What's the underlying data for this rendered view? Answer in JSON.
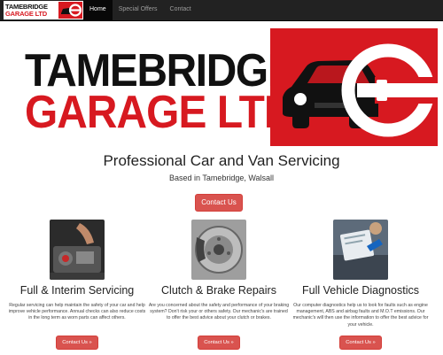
{
  "brand": {
    "nav_logo_line1": "TAMEBRIDGE",
    "nav_logo_line2": "GARAGE LTD",
    "banner_line1": "TAMEBRIDGE",
    "banner_line2": "GARAGE LTD",
    "accent_color": "#d71920"
  },
  "nav": {
    "items": [
      {
        "label": "Home",
        "active": true
      },
      {
        "label": "Special Offers",
        "active": false
      },
      {
        "label": "Contact",
        "active": false
      }
    ]
  },
  "hero": {
    "title": "Professional Car and Van Servicing",
    "subtitle": "Based in Tamebridge, Walsall",
    "button_label": "Contact Us"
  },
  "features": [
    {
      "title": "Full & Interim Servicing",
      "text": "Regular servicing can help maintain the safety of your car and help improve vehicle performance. Annual checks can also reduce costs in the long term as worn parts can affect others.",
      "button_label": "Contact Us »",
      "image": "engine-service-photo"
    },
    {
      "title": "Clutch & Brake Repairs",
      "text": "Are you concerned about the safety and performance of your braking system? Don't risk your or others safety. Our mechanic's are trained to offer the best advice about your clutch or brakes.",
      "button_label": "Contact Us »",
      "image": "brake-disc-photo"
    },
    {
      "title": "Full Vehicle Diagnostics",
      "text": "Our computer diagnostics help us to look for faults such as engine management, ABS and airbag faults and M.O.T emissions. Our mechanic's will then use the information to offer the best advice for your vehicle.",
      "button_label": "Contact Us »",
      "image": "diagnostics-photo"
    }
  ]
}
